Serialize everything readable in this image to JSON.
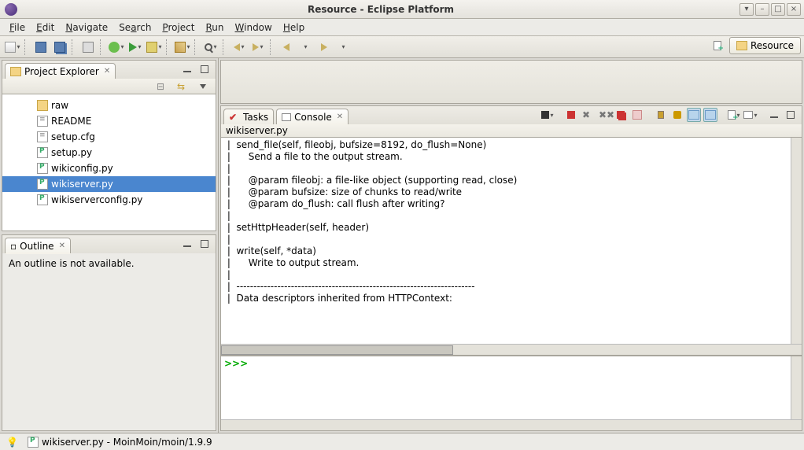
{
  "window": {
    "title": "Resource - Eclipse Platform"
  },
  "menu": {
    "file": "File",
    "edit": "Edit",
    "navigate": "Navigate",
    "search": "Search",
    "project": "Project",
    "run": "Run",
    "window": "Window",
    "help": "Help"
  },
  "perspective": {
    "label": "Resource"
  },
  "projectExplorer": {
    "title": "Project Explorer",
    "items": [
      {
        "icon": "folder",
        "label": "raw"
      },
      {
        "icon": "txt",
        "label": "README"
      },
      {
        "icon": "txt",
        "label": "setup.cfg"
      },
      {
        "icon": "py",
        "label": "setup.py"
      },
      {
        "icon": "py",
        "label": "wikiconfig.py"
      },
      {
        "icon": "py",
        "label": "wikiserver.py",
        "selected": true
      },
      {
        "icon": "py",
        "label": "wikiserverconfig.py"
      }
    ]
  },
  "outline": {
    "title": "Outline",
    "message": "An outline is not available."
  },
  "editorTabs": {
    "tasks": "Tasks",
    "console": "Console"
  },
  "console": {
    "header": "wikiserver.py",
    "output": " |  send_file(self, fileobj, bufsize=8192, do_flush=None)\n |      Send a file to the output stream.\n |      \n |      @param fileobj: a file-like object (supporting read, close)\n |      @param bufsize: size of chunks to read/write\n |      @param do_flush: call flush after writing?\n |  \n |  setHttpHeader(self, header)\n |  \n |  write(self, *data)\n |      Write to output stream.\n |  \n |  ----------------------------------------------------------------------\n |  Data descriptors inherited from HTTPContext:",
    "prompt": ">>> "
  },
  "status": {
    "file": "wikiserver.py - MoinMoin/moin/1.9.9"
  }
}
